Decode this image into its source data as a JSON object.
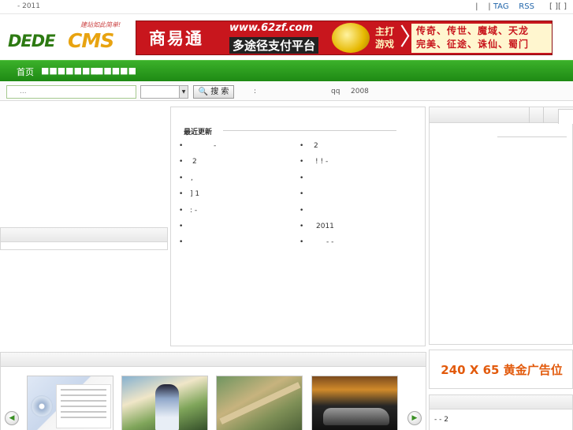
{
  "topbar": {
    "left_text": "- 2011",
    "sep1": "|",
    "sep2": "|",
    "tag_link": "TAG",
    "rss_link": "RSS",
    "brackets": "[  ][  ]"
  },
  "logo": {
    "word1": "DEDE",
    "word2": "CMS",
    "slogan": "建站如此简单!"
  },
  "banner": {
    "name": "商易通",
    "url": "www.62zf.com",
    "tagline": "多途径支付平台",
    "play_label": "主打游戏",
    "games_row1": "传奇、传世、魔域、天龙",
    "games_row2": "完美、征途、诛仙、蜀门",
    "accent": "#c8161d"
  },
  "nav": {
    "items": [
      "首页",
      "■■■■■■■",
      "■■■■■"
    ]
  },
  "search": {
    "placeholder": "...",
    "button_label": "搜 索",
    "hint": ":",
    "qq": "qq",
    "year": "2008"
  },
  "updates": {
    "heading": "最近更新",
    "left_col": [
      "-",
      "2",
      ",",
      "]     1",
      ":   -",
      "",
      ""
    ],
    "right_col": [
      "2",
      "!    ! -",
      "",
      "",
      "",
      "2011",
      "-    -"
    ]
  },
  "ad": {
    "text": "240 X 65 黄金广告位",
    "color": "#e25a0c"
  },
  "right_bottom": {
    "line": "-      -  2"
  },
  "gallery": {
    "prev_icon": "arrow-left-icon",
    "next_icon": "arrow-right-icon"
  },
  "colors": {
    "nav_green": "#1e8a14",
    "link_blue": "#2266aa"
  }
}
